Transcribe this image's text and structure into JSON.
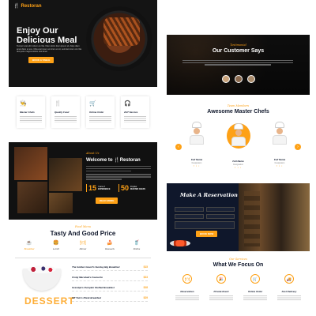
{
  "hero": {
    "brand": "Restoran",
    "title_line1": "Enjoy Our",
    "title_line2": "Delicious Meal",
    "body": "Tempor erat elitr rebum at clita. Diam dolor diam ipsum sit. Aliqu diam amet diam et eos. Clita erat ipsum et lorem et sit, sed stet lorem sit clita duo justo magna dolore erat amet",
    "cta": "BOOK A TABLE"
  },
  "services": [
    {
      "title": "Master Chefs",
      "icon": "chef-icon"
    },
    {
      "title": "Quality Food",
      "icon": "utensils-icon"
    },
    {
      "title": "Online Order",
      "icon": "cart-icon"
    },
    {
      "title": "24/7 Service",
      "icon": "headset-icon"
    }
  ],
  "about": {
    "script": "About Us",
    "title_prefix": "Welcome to",
    "brand": "Restoran",
    "stat1_num": "15",
    "stat1_l1": "Years of",
    "stat1_l2": "EXPERIENCE",
    "stat2_num": "50",
    "stat2_l1": "Popular",
    "stat2_l2": "MASTER CHEFS",
    "cta": "READ MORE"
  },
  "menu": {
    "script": "Food Menu",
    "title": "Tasty And Good Price",
    "tabs": [
      "Breakfast",
      "Lunch",
      "Dinner",
      "Desserts",
      "Drinks"
    ],
    "items": [
      {
        "name": "The Golden Gourd's Sunday Big Breakfast",
        "price": "$15"
      },
      {
        "name": "Cindy Marsdale's Favourite",
        "price": "$23"
      },
      {
        "name": "Grandpa's Pumpkin Stuffed Breakfast",
        "price": "$18"
      },
      {
        "name": "Off Tom's Plank Breakfast",
        "price": "$29"
      }
    ],
    "dessert_word": "DESSERT"
  },
  "testimonial": {
    "script": "Testimonial",
    "title": "Our Customer Says"
  },
  "chefs": {
    "script": "Team Members",
    "title": "Awesome Master Chefs",
    "members": [
      {
        "name": "Full Name",
        "role": "Designation"
      },
      {
        "name": "Full Name",
        "role": "Designation"
      },
      {
        "name": "Full Name",
        "role": "Designation"
      }
    ]
  },
  "reservation": {
    "title": "Make A Reservation",
    "cta": "BOOK NOW"
  },
  "focus": {
    "script": "Our Services",
    "title": "What We Focus On",
    "items": [
      "Reservation",
      "Private Event",
      "Online Order",
      "Fast Delivery"
    ]
  },
  "colors": {
    "accent": "#FEA116",
    "dark": "#0F172B"
  }
}
